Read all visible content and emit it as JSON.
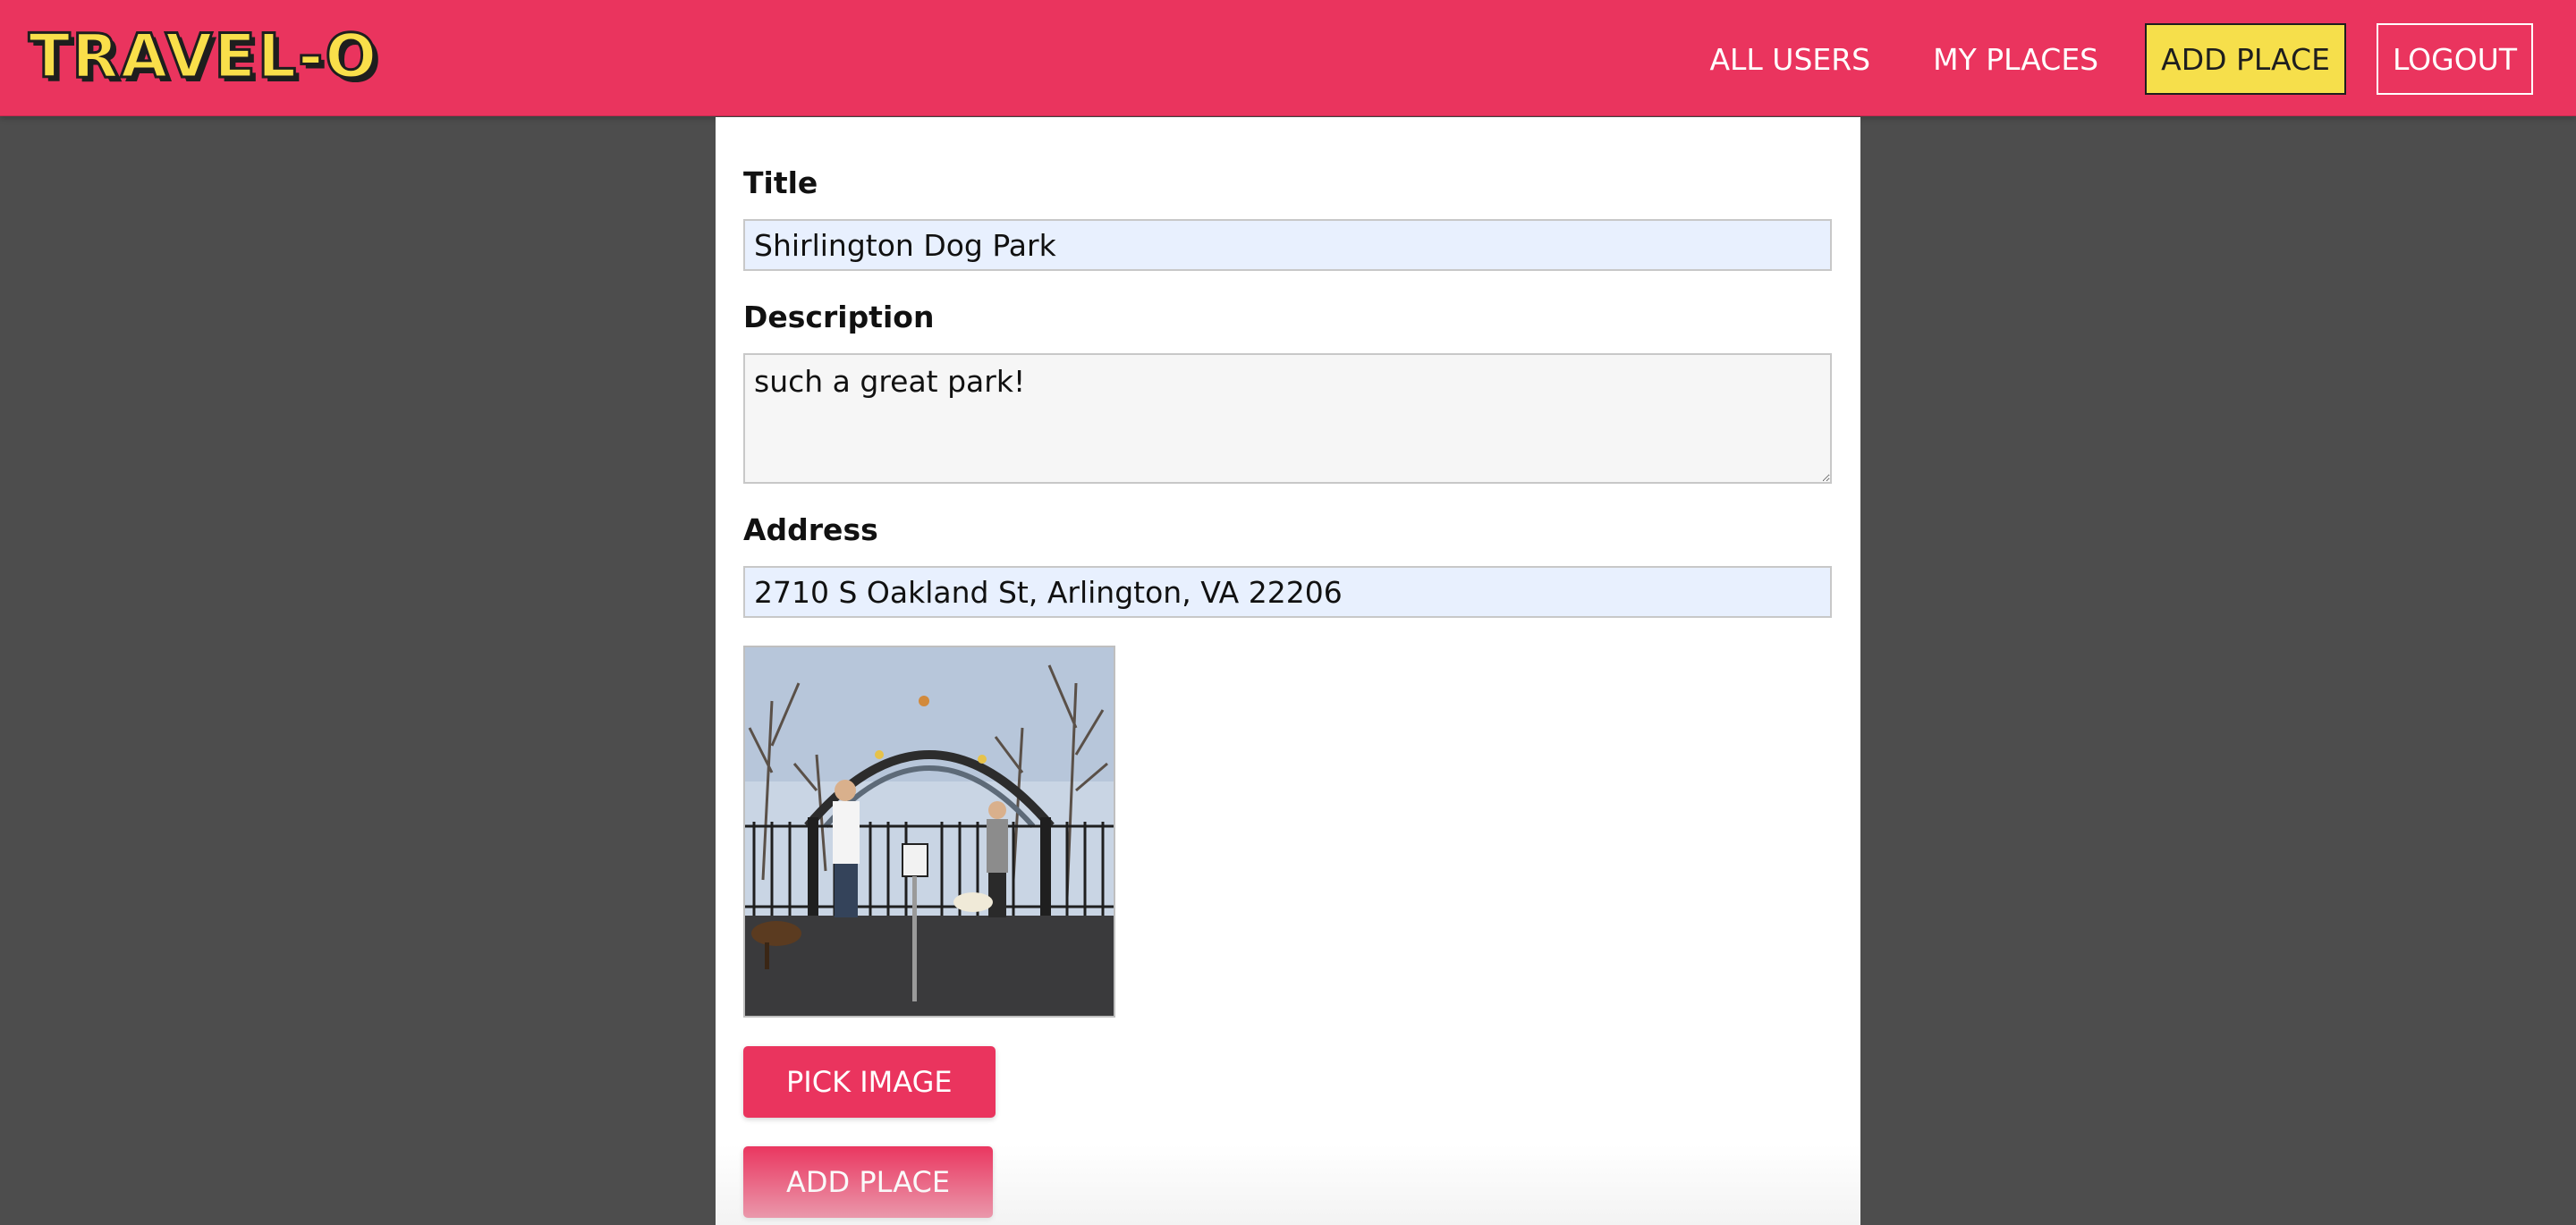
{
  "app": {
    "logo_text": "TRAVEL-O",
    "brand_color": "#ea345e",
    "accent_color": "#f6df4b"
  },
  "nav": {
    "all_users": "ALL USERS",
    "my_places": "MY PLACES",
    "add_place": "ADD PLACE",
    "logout": "LOGOUT"
  },
  "form": {
    "title_label": "Title",
    "title_value": "Shirlington Dog Park",
    "description_label": "Description",
    "description_value": "such a great park!",
    "address_label": "Address",
    "address_value": "2710 S Oakland St, Arlington, VA 22206",
    "image_preview_icon": "photo-of-dog-park-entrance",
    "pick_image_label": "PICK IMAGE",
    "submit_label": "ADD PLACE"
  }
}
